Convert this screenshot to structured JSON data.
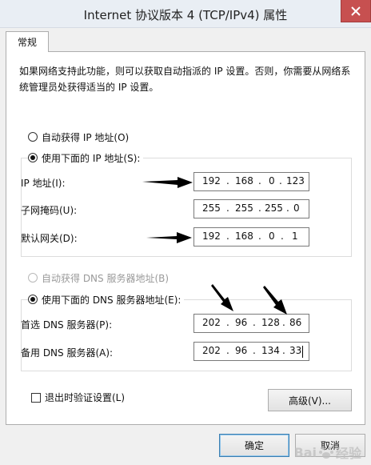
{
  "window": {
    "title": "Internet 协议版本 4 (TCP/IPv4) 属性"
  },
  "tabs": [
    {
      "label": "常规"
    }
  ],
  "description": "如果网络支持此功能，则可以获取自动指派的 IP 设置。否则，你需要从网络系统管理员处获得适当的 IP 设置。",
  "ip_section": {
    "auto_label": "自动获得 IP 地址(O)",
    "manual_label": "使用下面的 IP 地址(S):",
    "selected": "manual",
    "fields": [
      {
        "label": "IP 地址(I):",
        "octets": [
          "192",
          "168",
          "0",
          "123"
        ]
      },
      {
        "label": "子网掩码(U):",
        "octets": [
          "255",
          "255",
          "255",
          "0"
        ]
      },
      {
        "label": "默认网关(D):",
        "octets": [
          "192",
          "168",
          "0",
          "1"
        ]
      }
    ]
  },
  "dns_section": {
    "auto_label": "自动获得 DNS 服务器地址(B)",
    "manual_label": "使用下面的 DNS 服务器地址(E):",
    "selected": "manual",
    "fields": [
      {
        "label": "首选 DNS 服务器(P):",
        "octets": [
          "202",
          "96",
          "128",
          "86"
        ]
      },
      {
        "label": "备用 DNS 服务器(A):",
        "octets": [
          "202",
          "96",
          "134",
          "33"
        ]
      }
    ]
  },
  "validate_checkbox": {
    "label": "退出时验证设置(L)",
    "checked": false
  },
  "buttons": {
    "advanced": "高级(V)...",
    "ok": "确定",
    "cancel": "取消"
  },
  "watermark": {
    "text_left": "Bai",
    "text_right": "经验"
  },
  "icons": {
    "close": "close-icon",
    "arrow": "arrow-annotation-icon"
  },
  "colors": {
    "close_button": "#c75050",
    "primary_border": "#3c7fb1"
  }
}
